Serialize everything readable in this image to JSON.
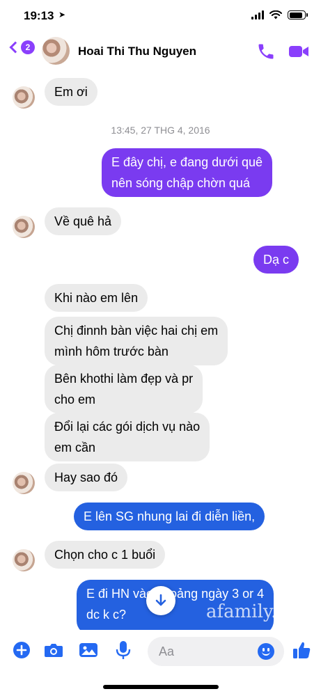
{
  "status_bar": {
    "time": "19:13",
    "location_arrow": "➤",
    "battery_level": 0.9
  },
  "header": {
    "back_badge": "2",
    "contact_name": "Hoai Thi Thu Nguyen",
    "call_icon": "phone-icon",
    "video_icon": "video-camera-icon",
    "accent_color": "#8a3ffc"
  },
  "messages": [
    {
      "id": "m1",
      "direction": "in",
      "text": "Em ơi"
    },
    {
      "id": "ts1",
      "type": "timestamp",
      "text": "13:45, 27 THG 4, 2016"
    },
    {
      "id": "m2",
      "direction": "out",
      "lines": [
        "E đây chị, e đang dưới quê",
        "nên sóng chập chờn quá"
      ]
    },
    {
      "id": "m3",
      "direction": "in",
      "text": "Về quê hả"
    },
    {
      "id": "m4",
      "direction": "out",
      "text": "Dạ c"
    },
    {
      "id": "m5",
      "direction": "in",
      "text": "Khi nào em lên"
    },
    {
      "id": "m6",
      "direction": "in",
      "lines": [
        "Chị đinnh bàn việc hai chị em",
        "mình hôm trước bàn"
      ]
    },
    {
      "id": "m7",
      "direction": "in",
      "lines": [
        "Bên khothi làm đẹp và pr",
        "cho em"
      ]
    },
    {
      "id": "m8",
      "direction": "in",
      "lines": [
        "Đổi lại các gói dịch vụ nào",
        "em cần"
      ]
    },
    {
      "id": "m9",
      "direction": "in",
      "text": "Hay sao đó"
    },
    {
      "id": "m10",
      "direction": "out",
      "text": "E lên SG nhung lai đi diễn liền,"
    },
    {
      "id": "m11",
      "direction": "in",
      "text": "Chọn cho c 1 buổi"
    },
    {
      "id": "m12",
      "direction": "out",
      "lines": [
        "E đi HN vào khoảng ngày 3 or 4",
        "dc k c?"
      ]
    }
  ],
  "colors": {
    "outgoing_purple": "#7a3bf0",
    "outgoing_blue": "#2461e0",
    "incoming": "#ebebeb"
  },
  "watermark": "afamily.vn",
  "composer": {
    "placeholder": "Aa",
    "icons": [
      "plus-icon",
      "camera-icon",
      "image-icon",
      "microphone-icon",
      "emoji-icon",
      "thumbs-up-icon"
    ]
  }
}
